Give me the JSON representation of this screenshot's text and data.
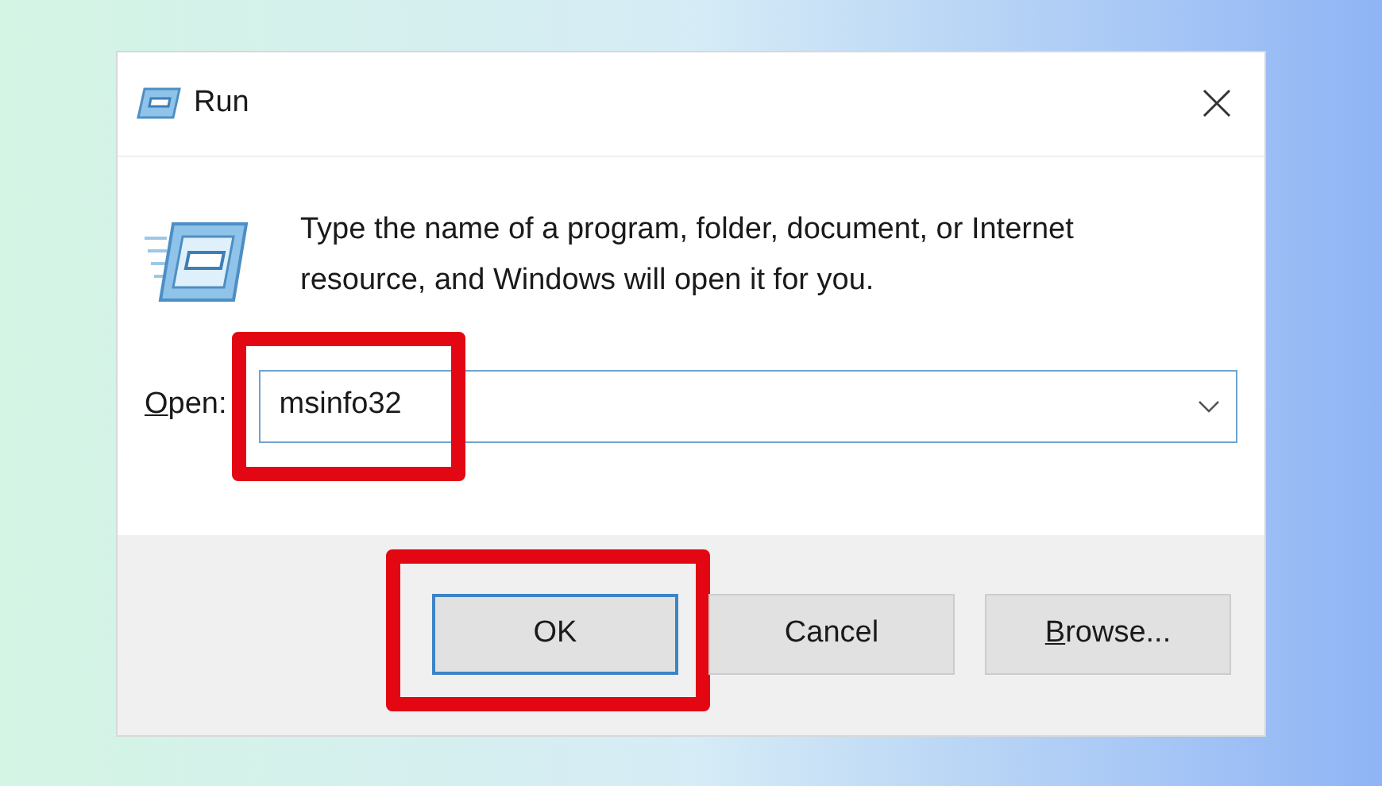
{
  "window": {
    "title": "Run"
  },
  "description": "Type the name of a program, folder, document, or Internet resource, and Windows will open it for you.",
  "open_field": {
    "label": {
      "access_key": "O",
      "rest": "pen:"
    },
    "value": "msinfo32",
    "highlighted": true
  },
  "buttons": [
    {
      "label": {
        "rest": "OK"
      },
      "default": true,
      "highlighted": true
    },
    {
      "label": {
        "rest": "Cancel"
      },
      "default": false,
      "highlighted": false
    },
    {
      "label": {
        "access_key": "B",
        "rest": "rowse..."
      },
      "default": false,
      "highlighted": false
    }
  ]
}
